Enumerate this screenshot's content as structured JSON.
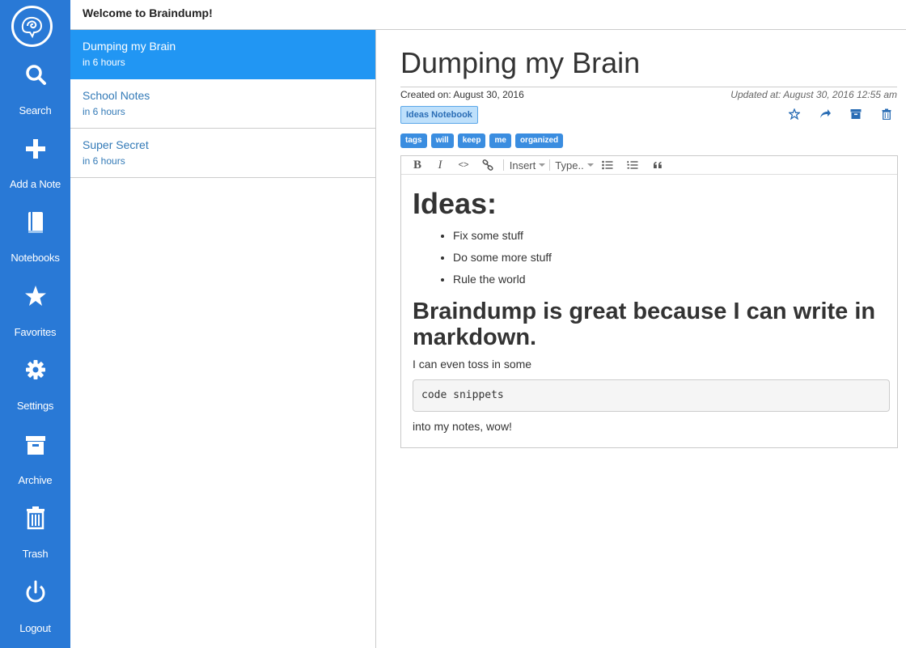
{
  "header": {
    "title": "Welcome to Braindump!"
  },
  "sidebar": {
    "logo_icon": "brain-icon",
    "items": [
      {
        "label": "Search",
        "icon": "search-icon"
      },
      {
        "label": "Add a Note",
        "icon": "plus-icon"
      },
      {
        "label": "Notebooks",
        "icon": "book-icon"
      },
      {
        "label": "Favorites",
        "icon": "star-icon"
      },
      {
        "label": "Settings",
        "icon": "gear-icon"
      },
      {
        "label": "Archive",
        "icon": "archive-icon"
      },
      {
        "label": "Trash",
        "icon": "trash-icon"
      },
      {
        "label": "Logout",
        "icon": "power-icon"
      }
    ],
    "color": "#2979d6"
  },
  "notes": [
    {
      "title": "Dumping my Brain",
      "time": "in 6 hours",
      "active": true
    },
    {
      "title": "School Notes",
      "time": "in 6 hours",
      "active": false
    },
    {
      "title": "Super Secret",
      "time": "in 6 hours",
      "active": false
    }
  ],
  "note": {
    "title": "Dumping my Brain",
    "created": "Created on: August 30, 2016",
    "updated": "Updated at: August 30, 2016 12:55 am",
    "notebook": "Ideas Notebook",
    "tags": [
      "tags",
      "will",
      "keep",
      "me",
      "organized"
    ],
    "actions": [
      {
        "icon": "star-outline-icon"
      },
      {
        "icon": "share-icon"
      },
      {
        "icon": "archive-icon"
      },
      {
        "icon": "trash-icon"
      }
    ]
  },
  "toolbar": {
    "bold": "B",
    "italic": "I",
    "code": "<>",
    "insert": "Insert",
    "type": "Type.."
  },
  "content": {
    "h1": "Ideas:",
    "list": [
      "Fix some stuff",
      "Do some more stuff",
      "Rule the world"
    ],
    "h2": "Braindump is great because I can write in markdown.",
    "p1": "I can even toss in some",
    "code": "code snippets",
    "p2": "into my notes, wow!"
  }
}
